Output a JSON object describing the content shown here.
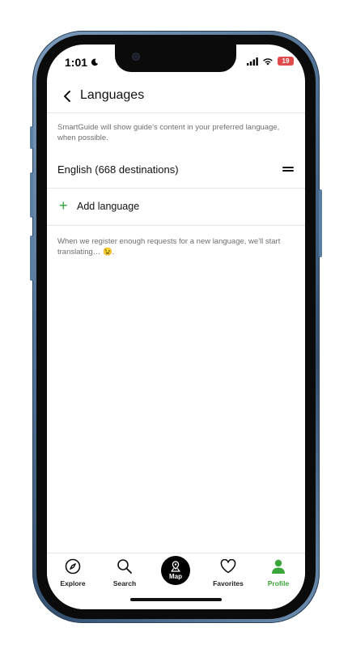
{
  "status": {
    "time": "1:01",
    "battery": "19"
  },
  "header": {
    "title": "Languages"
  },
  "info_text": "SmartGuide will show guide's content in your preferred language, when possible.",
  "language_item": {
    "label": "English (668 destinations)"
  },
  "add_language": {
    "icon": "+",
    "label": "Add language"
  },
  "note_text": "When we register enough requests for a new language, we'll start translating… 😉.",
  "tabs": [
    {
      "label": "Explore",
      "icon": "compass-icon"
    },
    {
      "label": "Search",
      "icon": "search-icon"
    },
    {
      "label": "Map",
      "icon": "map-pin-icon"
    },
    {
      "label": "Favorites",
      "icon": "heart-icon"
    },
    {
      "label": "Profile",
      "icon": "person-icon",
      "active": true
    }
  ],
  "colors": {
    "accent": "#3aa63a",
    "battery": "#e04b4b",
    "frame": "#4f6f92"
  }
}
